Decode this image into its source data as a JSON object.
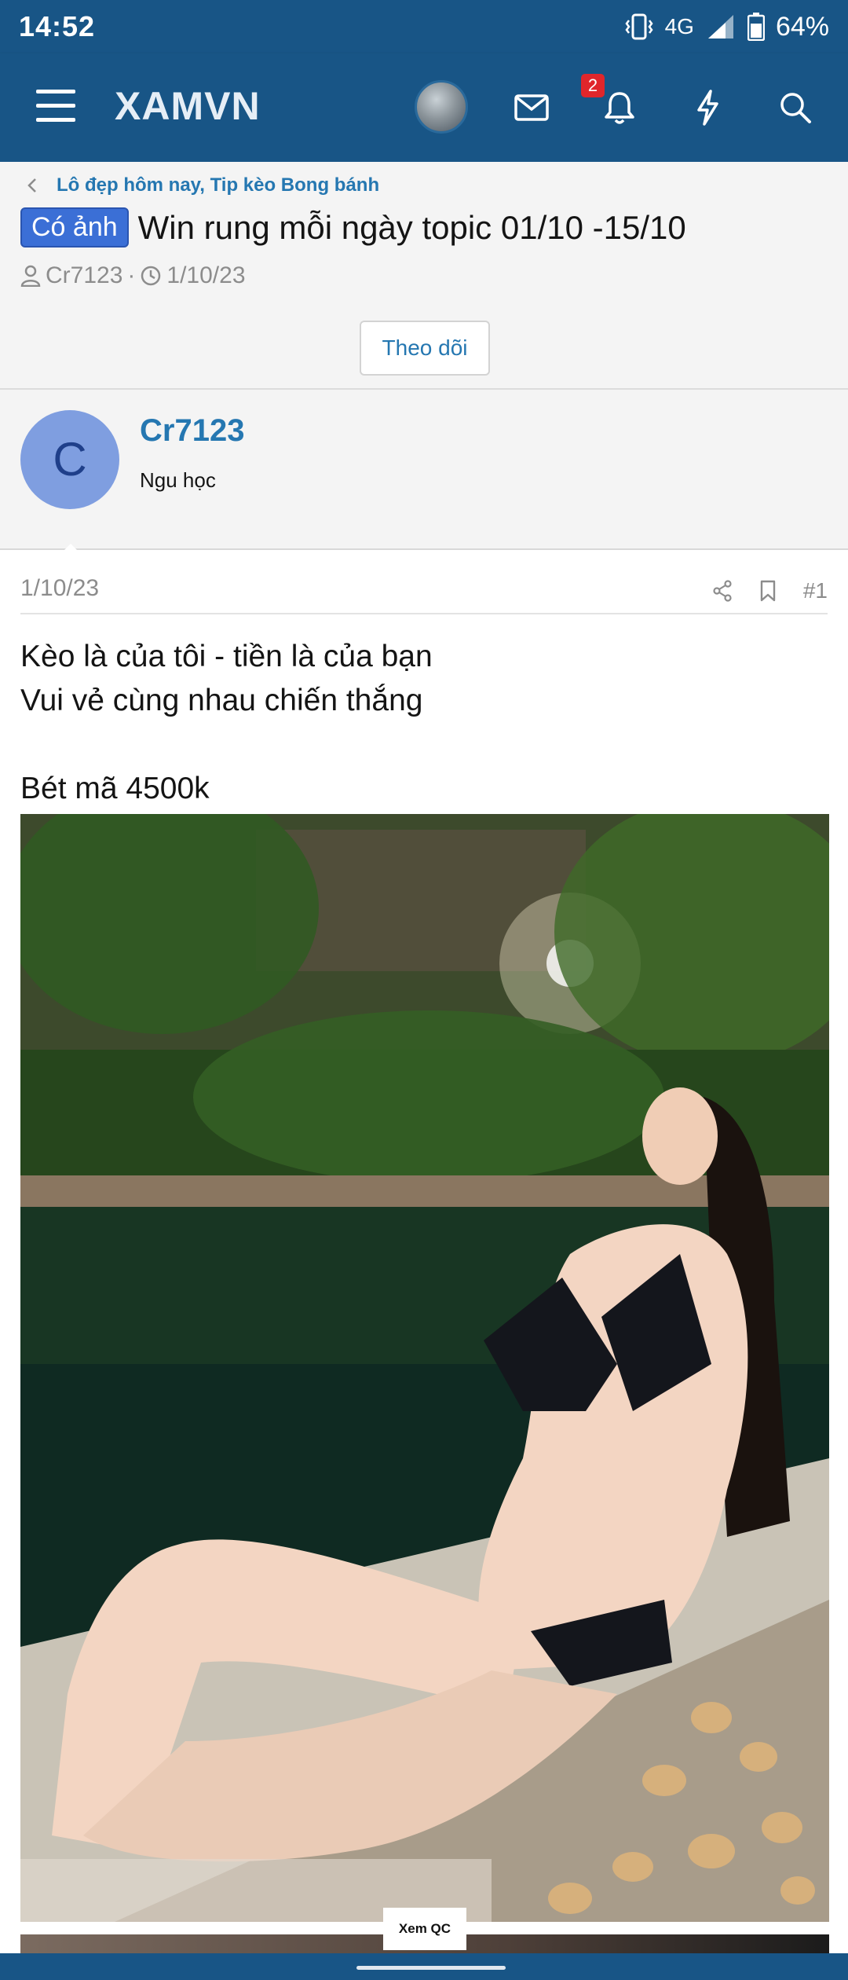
{
  "status_bar": {
    "time": "14:52",
    "network": "4G",
    "battery": "64%",
    "icons": [
      "vibrate-icon",
      "signal-icon",
      "battery-icon"
    ]
  },
  "header": {
    "logo": "XAMVN",
    "notification_count": "2",
    "icons": [
      "menu-icon",
      "avatar",
      "mail-icon",
      "bell-icon",
      "lightning-icon",
      "search-icon"
    ],
    "bar_color": "#185586"
  },
  "thread": {
    "breadcrumb": "Lô đẹp hôm nay, Tip kèo Bong bánh",
    "prefix": "Có ảnh",
    "title": "Win rung mỗi ngày topic 01/10 -15/10",
    "author": "Cr7123",
    "date": "1/10/23",
    "follow_label": "Theo dõi"
  },
  "author_block": {
    "initial": "C",
    "name": "Cr7123",
    "user_title": "Ngu học",
    "avatar_color": "#7f9ee0"
  },
  "post": {
    "date": "1/10/23",
    "number": "#1",
    "lines": [
      "Kèo là của tôi - tiền là của bạn",
      "Vui vẻ cùng nhau chiến thắng",
      "",
      "Bét mã 4500k"
    ],
    "ad_label": "Xem QC"
  },
  "colors": {
    "accent": "#2577b1",
    "prefix_bg": "#3b6fd6",
    "badge": "#e0262b"
  }
}
